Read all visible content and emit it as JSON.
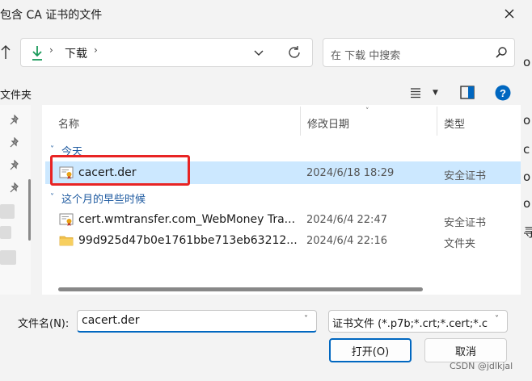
{
  "window": {
    "title": "包含 CA 证书的文件",
    "close_icon": "close-icon"
  },
  "address_bar": {
    "folder": "下载",
    "separator": "›"
  },
  "search": {
    "placeholder": "在 下载 中搜索"
  },
  "toolbar": {
    "left_label": "文件夹"
  },
  "columns": {
    "name": "名称",
    "date": "修改日期",
    "type": "类型"
  },
  "groups": [
    {
      "label": "今天",
      "files": [
        {
          "name": "cacert.der",
          "date": "2024/6/18 18:29",
          "type": "安全证书",
          "icon": "certificate-icon",
          "selected": true
        }
      ]
    },
    {
      "label": "这个月的早些时候",
      "files": [
        {
          "name": "cert.wmtransfer.com_WebMoney Tra...",
          "date": "2024/6/4 22:47",
          "type": "安全证书",
          "icon": "certificate-icon",
          "selected": false
        },
        {
          "name": "99d925d47b0e1761bbe713eb63212...",
          "date": "2024/6/4 22:16",
          "type": "文件夹",
          "icon": "folder-icon",
          "selected": false
        }
      ]
    }
  ],
  "bottom": {
    "filename_label": "文件名(N):",
    "filename_value": "cacert.der",
    "filetype_value": "证书文件 (*.p7b;*.crt;*.cert;*.c",
    "open_button": "打开(O)",
    "cancel_button": "取消"
  },
  "right_fragments": [
    "o",
    "o",
    "c",
    "o",
    "o",
    "寻"
  ],
  "watermark": "CSDN @jdlkjal",
  "colors": {
    "accent": "#0067c0",
    "selection": "#cce8ff",
    "highlight_box": "#e82424",
    "group_label": "#1e5aa0"
  }
}
